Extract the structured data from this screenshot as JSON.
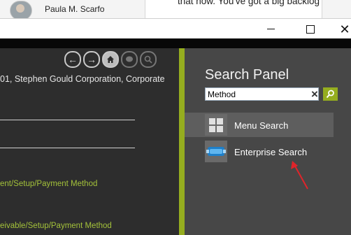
{
  "chat": {
    "contact_name": "Paula M. Scarfo",
    "message_fragment": "that now. You've got a big backlog"
  },
  "main": {
    "breadcrumb_title": "01, Stephen Gould Corporation, Corporate",
    "results": [
      "ent/Setup/Payment Method",
      "eivable/Setup/Payment Method"
    ]
  },
  "search_panel": {
    "title": "Search Panel",
    "search_value": "Method",
    "menu_items": [
      {
        "label": "Menu Search",
        "icon": "grid-icon"
      },
      {
        "label": "Enterprise Search",
        "icon": "enterprise-search-icon"
      }
    ]
  },
  "colors": {
    "accent": "#95ad1f",
    "link": "#a3c13a",
    "annotation": "#e0242a"
  }
}
